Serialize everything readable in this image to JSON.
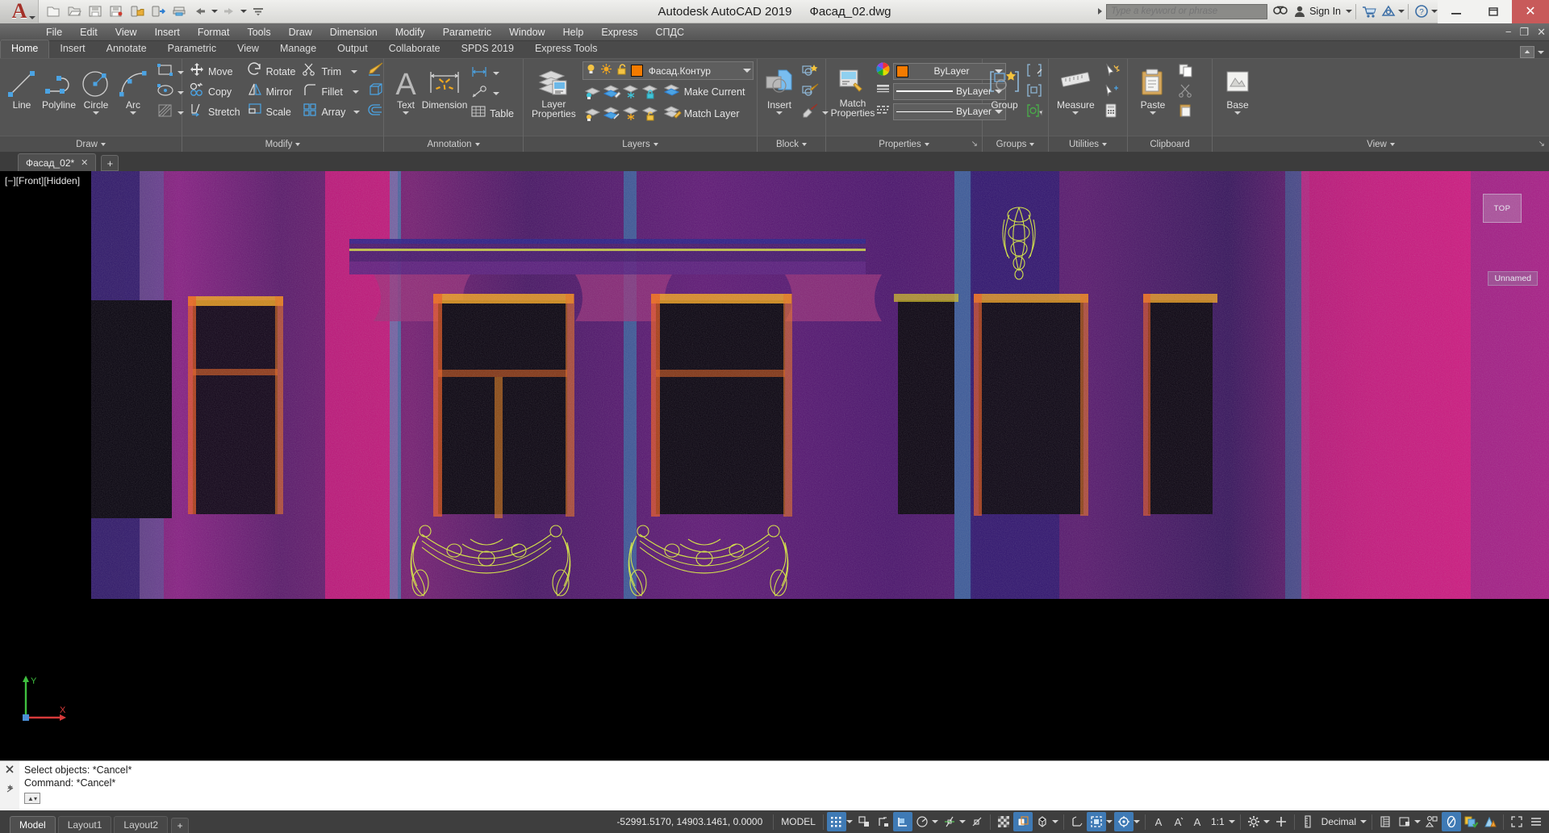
{
  "titlebar": {
    "app_title": "Autodesk AutoCAD 2019",
    "file_name": "Фасад_02.dwg",
    "search_placeholder": "Type a keyword or phrase",
    "sign_in": "Sign In",
    "quick_access": [
      {
        "name": "new-file-icon",
        "label": "New"
      },
      {
        "name": "open-file-icon",
        "label": "Open"
      },
      {
        "name": "save-icon",
        "label": "Save"
      },
      {
        "name": "save-as-icon",
        "label": "Save As"
      },
      {
        "name": "open-from-web-icon",
        "label": "Open from Web & Mobile"
      },
      {
        "name": "save-to-web-icon",
        "label": "Save to Web & Mobile"
      },
      {
        "name": "plot-icon",
        "label": "Plot"
      },
      {
        "name": "undo-icon",
        "label": "Undo"
      },
      {
        "name": "redo-icon",
        "label": "Redo"
      },
      {
        "name": "customize-qat-icon",
        "label": "Customize Quick Access Toolbar"
      }
    ],
    "window_buttons": {
      "minimize": "—",
      "restore": "❐",
      "close": "✕"
    }
  },
  "menubar": {
    "items": [
      {
        "label": "File",
        "accel": "F"
      },
      {
        "label": "Edit",
        "accel": "E"
      },
      {
        "label": "View",
        "accel": "V"
      },
      {
        "label": "Insert",
        "accel": "I"
      },
      {
        "label": "Format",
        "accel": "o"
      },
      {
        "label": "Tools",
        "accel": "T"
      },
      {
        "label": "Draw",
        "accel": "D"
      },
      {
        "label": "Dimension",
        "accel": "n"
      },
      {
        "label": "Modify",
        "accel": "M"
      },
      {
        "label": "Parametric",
        "accel": "P"
      },
      {
        "label": "Window",
        "accel": "W"
      },
      {
        "label": "Help",
        "accel": "H"
      },
      {
        "label": "Express",
        "accel": ""
      },
      {
        "label": "СПДС",
        "accel": ""
      }
    ],
    "right_controls": [
      "minimize-ribbon",
      "restore-window",
      "close-window"
    ]
  },
  "ribbon_tabs": {
    "items": [
      "Home",
      "Insert",
      "Annotate",
      "Parametric",
      "View",
      "Manage",
      "Output",
      "Collaborate",
      "SPDS 2019",
      "Express Tools"
    ],
    "active": "Home"
  },
  "ribbon": {
    "panels": [
      {
        "title": "Draw",
        "big_buttons": [
          {
            "label": "Line",
            "icon": "line-icon",
            "dropdown": false
          },
          {
            "label": "Polyline",
            "icon": "polyline-icon",
            "dropdown": false
          },
          {
            "label": "Circle",
            "icon": "circle-icon",
            "dropdown": true
          },
          {
            "label": "Arc",
            "icon": "arc-icon",
            "dropdown": true
          }
        ],
        "small_buttons": [
          {
            "label": "",
            "icon": "rectangle-icon",
            "dropdown": true
          },
          {
            "label": "",
            "icon": "ellipse-icon",
            "dropdown": true
          },
          {
            "label": "",
            "icon": "hatch-icon",
            "dropdown": true
          }
        ]
      },
      {
        "title": "Modify",
        "small_buttons": [
          {
            "label": "Move",
            "icon": "move-icon"
          },
          {
            "label": "Rotate",
            "icon": "rotate-icon"
          },
          {
            "label": "Trim",
            "icon": "trim-icon",
            "dropdown": true
          },
          {
            "label": "",
            "icon": "erase-icon"
          },
          {
            "label": "Copy",
            "icon": "copy-icon"
          },
          {
            "label": "Mirror",
            "icon": "mirror-icon"
          },
          {
            "label": "Fillet",
            "icon": "fillet-icon",
            "dropdown": true
          },
          {
            "label": "",
            "icon": "3d-array-icon"
          },
          {
            "label": "Stretch",
            "icon": "stretch-icon"
          },
          {
            "label": "Scale",
            "icon": "scale-icon"
          },
          {
            "label": "Array",
            "icon": "array-icon",
            "dropdown": true
          },
          {
            "label": "",
            "icon": "offset-icon"
          }
        ]
      },
      {
        "title": "Annotation",
        "big_buttons": [
          {
            "label": "Text",
            "icon": "text-icon",
            "dropdown": true
          },
          {
            "label": "Dimension",
            "icon": "dimension-icon",
            "dropdown": false
          }
        ],
        "small_buttons": [
          {
            "label": "",
            "icon": "linear-dimension-icon",
            "dropdown": true
          },
          {
            "label": "",
            "icon": "leader-icon",
            "dropdown": true
          },
          {
            "label": "Table",
            "icon": "table-icon"
          }
        ]
      },
      {
        "title": "Layers",
        "big_buttons": [
          {
            "label": "Layer\nProperties",
            "icon": "layer-properties-icon"
          }
        ],
        "current_layer": {
          "name": "Фасад.Контур",
          "color": "#f47b00",
          "on": true,
          "frozen": false,
          "locked": false
        },
        "small_buttons": [
          {
            "label": "",
            "icon": "layer-off-icon"
          },
          {
            "label": "",
            "icon": "isolate-layer-icon"
          },
          {
            "label": "",
            "icon": "freeze-layer-icon"
          },
          {
            "label": "",
            "icon": "lock-layer-icon"
          },
          {
            "label": "Make Current",
            "icon": "make-current-icon"
          },
          {
            "label": "",
            "icon": "turn-all-layers-on-icon"
          },
          {
            "label": "",
            "icon": "unisolate-layer-icon"
          },
          {
            "label": "",
            "icon": "thaw-all-layers-icon"
          },
          {
            "label": "",
            "icon": "unlock-layer-icon"
          },
          {
            "label": "Match Layer",
            "icon": "match-layer-icon"
          }
        ]
      },
      {
        "title": "Block",
        "big_buttons": [
          {
            "label": "Insert",
            "icon": "insert-block-icon",
            "dropdown": true
          }
        ],
        "small_buttons": [
          {
            "label": "",
            "icon": "create-block-icon"
          },
          {
            "label": "",
            "icon": "edit-block-icon"
          },
          {
            "label": "",
            "icon": "edit-attribute-icon",
            "dropdown": true
          }
        ]
      },
      {
        "title": "Properties",
        "expand_arrow": true,
        "big_buttons": [
          {
            "label": "Match\nProperties",
            "icon": "match-properties-icon"
          }
        ],
        "dropdowns": [
          {
            "name": "object-color",
            "value": "ByLayer",
            "swatch": "#f47b00",
            "icon": "color-wheel-icon"
          },
          {
            "name": "lineweight",
            "value": "ByLayer",
            "icon": "lineweight-icon"
          },
          {
            "name": "linetype",
            "value": "ByLayer",
            "icon": "linetype-icon"
          }
        ]
      },
      {
        "title": "Groups",
        "big_buttons": [
          {
            "label": "Group",
            "icon": "group-icon"
          }
        ],
        "small_buttons": [
          {
            "label": "",
            "icon": "ungroup-icon"
          },
          {
            "label": "",
            "icon": "group-edit-icon"
          },
          {
            "label": "",
            "icon": "group-selection-on-off-icon"
          }
        ]
      },
      {
        "title": "Utilities",
        "big_buttons": [
          {
            "label": "Measure",
            "icon": "measure-icon",
            "dropdown": true
          }
        ],
        "small_buttons": [
          {
            "label": "",
            "icon": "quick-select-icon"
          },
          {
            "label": "",
            "icon": "id-point-icon"
          },
          {
            "label": "",
            "icon": "calculator-icon"
          }
        ]
      },
      {
        "title": "Clipboard",
        "big_buttons": [
          {
            "label": "Paste",
            "icon": "paste-icon",
            "dropdown": true
          }
        ],
        "small_buttons": [
          {
            "label": "",
            "icon": "copy-clip-icon"
          },
          {
            "label": "",
            "icon": "cut-clip-icon"
          },
          {
            "label": "",
            "icon": "paste-special-icon"
          }
        ]
      },
      {
        "title": "View",
        "expand_arrow": true,
        "big_buttons": [
          {
            "label": "Base",
            "icon": "base-view-icon",
            "dropdown": true
          }
        ],
        "small_buttons": [
          {
            "label": "",
            "icon": "named-views-icon"
          },
          {
            "label": "",
            "icon": "viewport-config-icon"
          }
        ]
      }
    ]
  },
  "drawing_tabs": {
    "tabs": [
      {
        "label": "Фасад_02*",
        "close": "✕",
        "active": true
      }
    ],
    "add_label": "+"
  },
  "canvas": {
    "viewport_label": "[−][Front][Hidden]",
    "viewcube_label": "TOP",
    "unnamed_label": "Unnamed",
    "ucs_axes": {
      "x": "X",
      "y": "Y"
    },
    "point_cloud_description": "Colorized point cloud scan of a classical building facade with pilasters, three tall windows, cornice, brackets and two decorative garlands"
  },
  "command_line": {
    "history": [
      "Select objects: *Cancel*",
      "Command: *Cancel*"
    ],
    "input_value": "",
    "prompt_icon": "command-prompt-icon"
  },
  "statusbar": {
    "layout_tabs": [
      {
        "label": "Model",
        "active": true
      },
      {
        "label": "Layout1",
        "active": false
      },
      {
        "label": "Layout2",
        "active": false
      }
    ],
    "add_layout": "+",
    "coordinates": "-52991.5170, 14903.1461, 0.0000",
    "space_mode": "MODEL",
    "annotation_scale": "1:1",
    "units": "Decimal",
    "toggles": [
      {
        "name": "grid-display-toggle",
        "icon": "grid-icon",
        "on": true,
        "dropdown": true
      },
      {
        "name": "snap-mode-toggle",
        "icon": "snap-icon",
        "on": false
      },
      {
        "name": "infer-constraints-toggle",
        "icon": "infer-constraints-icon",
        "on": false
      },
      {
        "name": "ortho-mode-toggle",
        "icon": "ortho-icon",
        "on": true
      },
      {
        "name": "polar-tracking-toggle",
        "icon": "polar-icon",
        "on": false,
        "dropdown": true
      },
      {
        "name": "object-snap-tracking-toggle",
        "icon": "osnap-tracking-icon",
        "on": false,
        "dropdown": true
      },
      {
        "name": "object-snap-toggle",
        "icon": "osnap-icon",
        "on": false,
        "dropdown": true
      },
      {
        "name": "lineweight-toggle",
        "icon": "lineweight-display-icon",
        "on": false
      },
      {
        "name": "transparency-toggle",
        "icon": "transparency-icon",
        "on": false
      },
      {
        "name": "selection-cycling-toggle",
        "icon": "selection-cycling-icon",
        "on": true
      },
      {
        "name": "3d-osnap-toggle",
        "icon": "3d-osnap-icon",
        "on": false,
        "dropdown": true
      },
      {
        "name": "dynamic-ucs-toggle",
        "icon": "dynamic-ucs-icon",
        "on": false
      },
      {
        "name": "selection-filter-toggle",
        "icon": "selection-filter-icon",
        "on": true,
        "dropdown": true
      },
      {
        "name": "gizmo-toggle",
        "icon": "gizmo-icon",
        "on": true,
        "dropdown": true
      },
      {
        "name": "annotation-visibility-toggle",
        "icon": "annotation-visibility-icon",
        "on": false
      },
      {
        "name": "autoscale-toggle",
        "icon": "autoscale-icon",
        "on": false
      },
      {
        "name": "annotation-scale-toggle",
        "icon": "annotation-scale-icon",
        "on": false,
        "dropdown": true
      },
      {
        "name": "workspace-switching-toggle",
        "icon": "gear-icon",
        "on": false,
        "dropdown": true
      },
      {
        "name": "hardware-acceleration-toggle",
        "icon": "plus-icon",
        "on": false
      },
      {
        "name": "units-toggle",
        "icon": "units-icon",
        "on": false,
        "dropdown": true
      },
      {
        "name": "quick-properties-toggle",
        "icon": "quick-properties-icon",
        "on": false
      },
      {
        "name": "lock-ui-toggle",
        "icon": "lock-ui-icon",
        "on": false,
        "dropdown": true
      },
      {
        "name": "isolate-objects-toggle",
        "icon": "isolate-objects-icon",
        "on": false
      },
      {
        "name": "graphics-performance-toggle",
        "icon": "graphics-performance-icon",
        "on": true
      },
      {
        "name": "clean-screen-toggle",
        "icon": "clean-screen-icon",
        "on": false
      },
      {
        "name": "customization-toggle",
        "icon": "hamburger-icon",
        "on": false
      }
    ]
  }
}
